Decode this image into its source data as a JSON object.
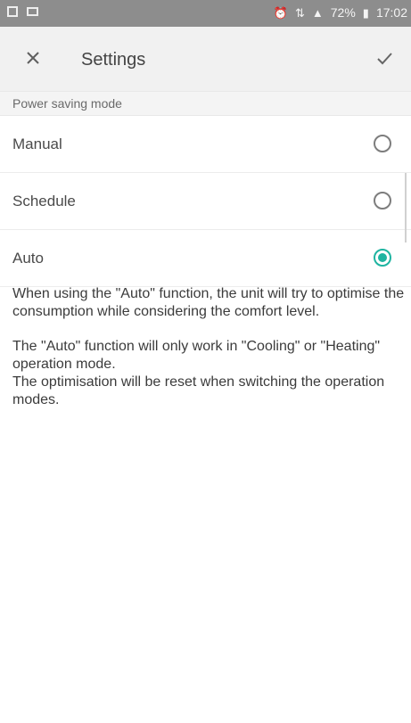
{
  "status_bar": {
    "left_icons": [
      "image-icon",
      "mail-icon"
    ],
    "right_icons": [
      "alarm-icon",
      "network-icon",
      "signal-icon",
      "battery-icon"
    ],
    "battery_percent": "72%",
    "time": "17:02"
  },
  "header": {
    "close_icon": "close-icon",
    "title": "Settings",
    "confirm_icon": "check-icon"
  },
  "section": {
    "title": "Power saving mode"
  },
  "options": [
    {
      "label": "Manual",
      "selected": false
    },
    {
      "label": "Schedule",
      "selected": false
    },
    {
      "label": "Auto",
      "selected": true
    }
  ],
  "description": {
    "paragraph1": "When using the \"Auto\" function, the unit will try to optimise the consumption while considering the comfort level.",
    "paragraph2_line1": "The \"Auto\" function will only work in \"Cooling\" or \"Heating\" operation mode.",
    "paragraph2_line2": "The optimisation will be reset when switching the operation modes."
  },
  "colors": {
    "accent": "#1fb4a1",
    "status_bar": "#8d8d8d",
    "header": "#f1f1f1"
  }
}
